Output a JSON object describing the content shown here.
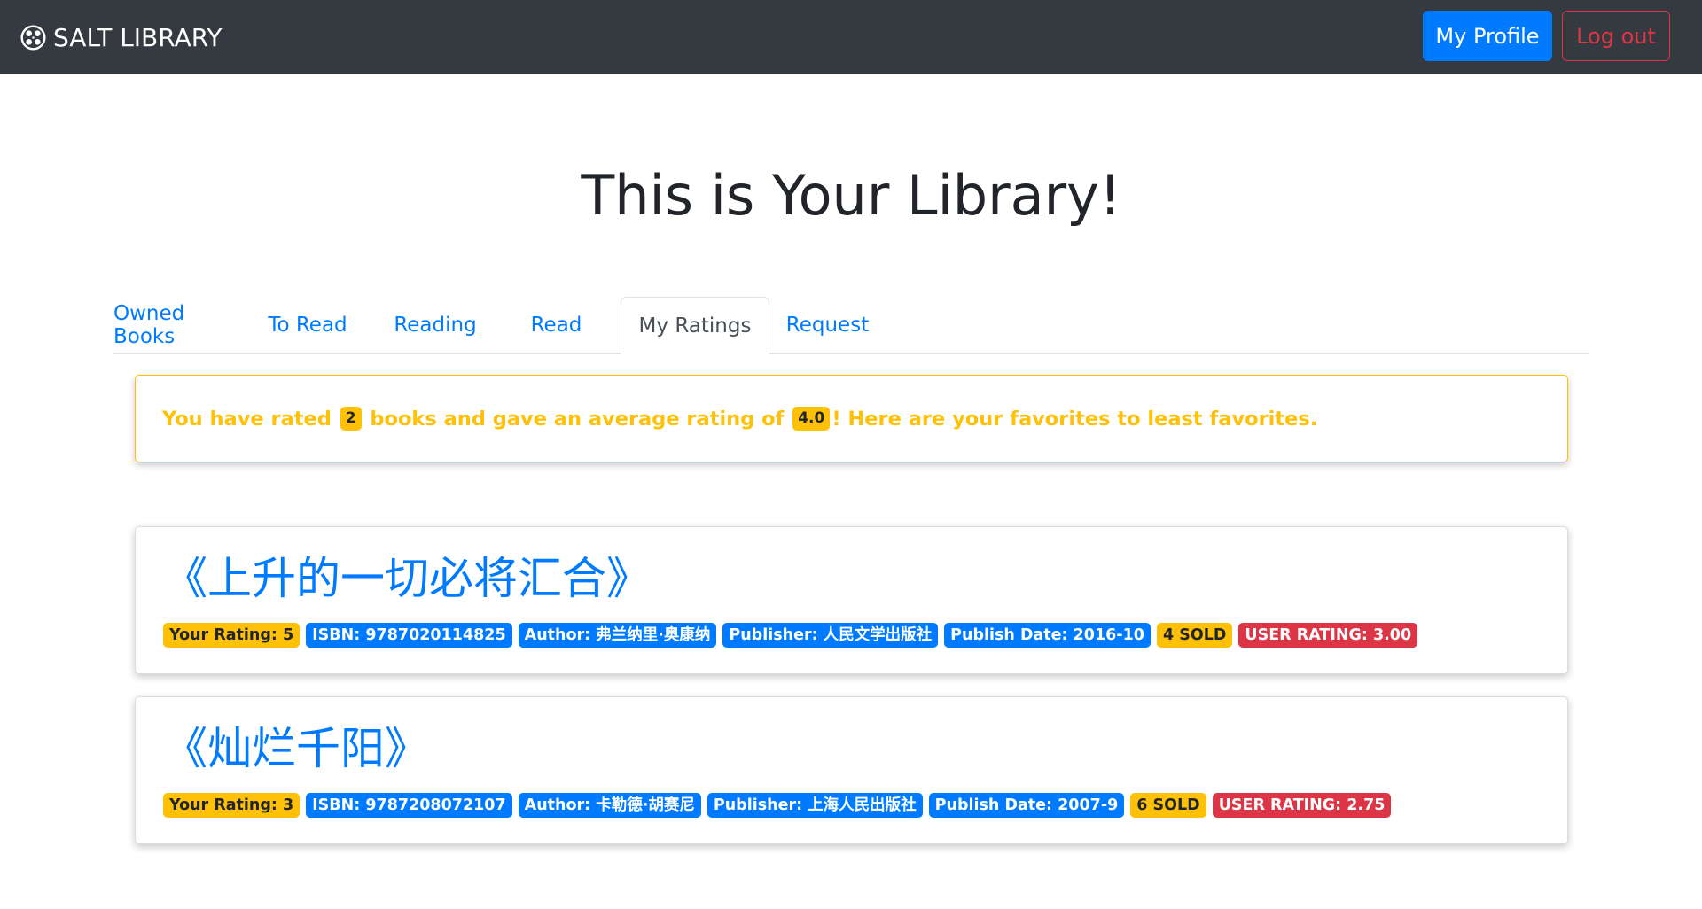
{
  "navbar": {
    "brand": "SALT LIBRARY",
    "brand_icon": "film-reel-icon",
    "profile_button": "My Profile",
    "logout_button": "Log out"
  },
  "page": {
    "title": "This is Your Library!"
  },
  "tabs": [
    {
      "label": "Owned Books",
      "active": false
    },
    {
      "label": "To Read",
      "active": false
    },
    {
      "label": "Reading",
      "active": false
    },
    {
      "label": "Read",
      "active": false
    },
    {
      "label": "My Ratings",
      "active": true
    },
    {
      "label": "Request",
      "active": false
    }
  ],
  "summary": {
    "text_1": "You have rated ",
    "count": "2",
    "text_2": " books and gave an average rating of ",
    "average": "4.0",
    "text_3": "! Here are your favorites to least favorites."
  },
  "books": [
    {
      "title": "《上升的一切必将汇合》",
      "your_rating": "Your Rating: 5",
      "isbn": "ISBN: 9787020114825",
      "author": "Author: 弗兰纳里·奥康纳",
      "publisher": "Publisher: 人民文学出版社",
      "publish_date": "Publish Date: 2016-10",
      "sold_count": "4",
      "sold_label": "SOLD",
      "user_rating_label": "USER RATING:",
      "user_rating_value": "3.00"
    },
    {
      "title": "《灿烂千阳》",
      "your_rating": "Your Rating: 3",
      "isbn": "ISBN: 9787208072107",
      "author": "Author: 卡勒德·胡赛尼",
      "publisher": "Publisher: 上海人民出版社",
      "publish_date": "Publish Date: 2007-9",
      "sold_count": "6",
      "sold_label": "SOLD",
      "user_rating_label": "USER RATING:",
      "user_rating_value": "2.75"
    }
  ],
  "colors": {
    "navbar_bg": "#343a40",
    "primary": "#007bff",
    "warning": "#ffc107",
    "danger": "#dc3545"
  }
}
